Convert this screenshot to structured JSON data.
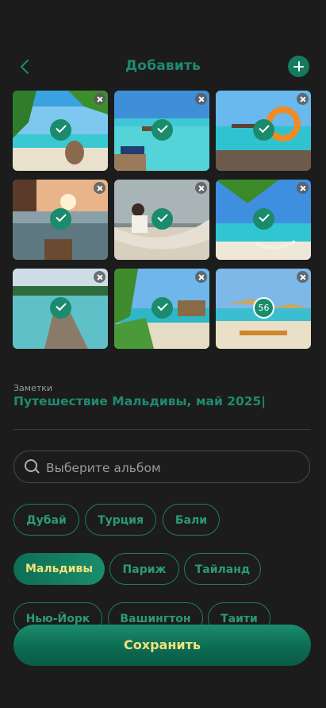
{
  "header": {
    "title": "Добавить",
    "back_icon": "chevron-left-icon",
    "add_icon": "plus-icon"
  },
  "photos": [
    {
      "selected": true
    },
    {
      "selected": true
    },
    {
      "selected": true
    },
    {
      "selected": true
    },
    {
      "selected": true
    },
    {
      "selected": true
    },
    {
      "selected": true
    },
    {
      "selected": true
    },
    {
      "selected": false,
      "count": "56"
    }
  ],
  "notes": {
    "label": "Заметки",
    "value": "Путешествие Мальдивы, май 2025|"
  },
  "search": {
    "placeholder": "Выберите альбом"
  },
  "albums": {
    "row1": [
      "Дубай",
      "Турция",
      "Бали"
    ],
    "row2": [
      "Мальдивы",
      "Париж",
      "Тайланд"
    ],
    "row3": [
      "Нью-Йорк",
      "Вашингтон",
      "Таити"
    ],
    "active": "Мальдивы"
  },
  "save_label": "Сохранить",
  "colors": {
    "accent": "#1a8d6c",
    "background": "#1c1c1c",
    "highlight_text": "#f2e27a"
  }
}
